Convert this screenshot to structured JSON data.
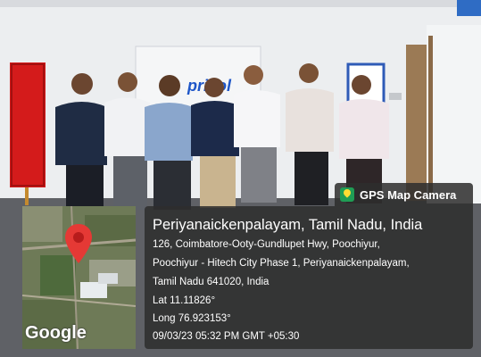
{
  "photo": {
    "description_icon": "group-photo",
    "wall_sign_text": "pricol"
  },
  "stamp": {
    "app_label": "GPS Map Camera",
    "app_icon": "map-pin-camera-icon",
    "title": "Periyanaickenpalayam, Tamil Nadu, India",
    "address_line1": "126, Coimbatore-Ooty-Gundlupet Hwy, Poochiyur,",
    "address_line2": "Poochiyur - Hitech City Phase 1, Periyanaickenpalayam,",
    "address_line3": "Tamil Nadu 641020, India",
    "latitude": "Lat 11.11826°",
    "longitude": "Long 76.923153°",
    "timestamp": "09/03/23 05:32 PM GMT +05:30"
  },
  "map": {
    "attribution": "Google",
    "pin_color": "#e53935"
  }
}
